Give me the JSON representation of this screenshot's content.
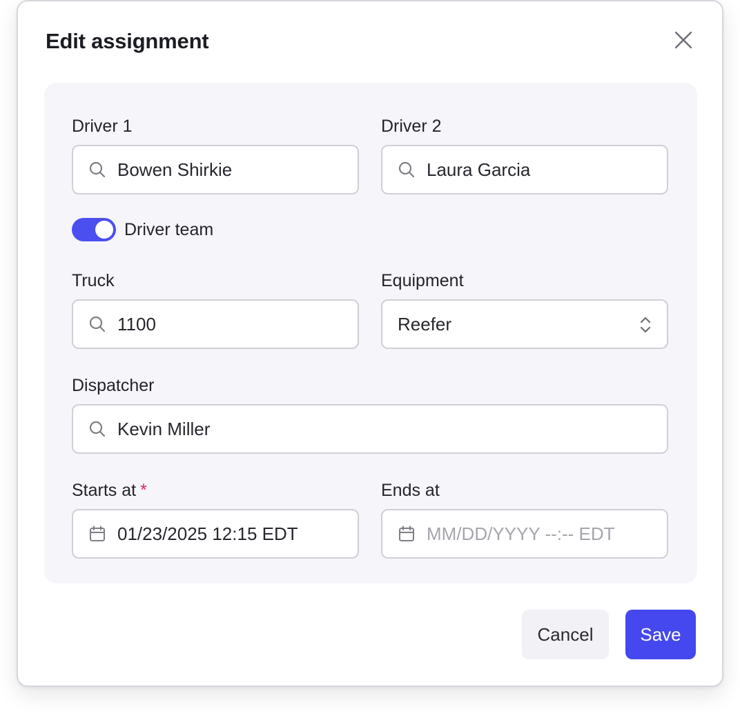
{
  "dialog": {
    "title": "Edit assignment",
    "close_icon": "close-icon"
  },
  "form": {
    "driver1": {
      "label": "Driver 1",
      "value": "Bowen Shirkie",
      "icon": "search-icon"
    },
    "driver2": {
      "label": "Driver 2",
      "value": "Laura Garcia",
      "icon": "search-icon"
    },
    "driver_team": {
      "label": "Driver team",
      "checked": true
    },
    "truck": {
      "label": "Truck",
      "value": "1100",
      "icon": "search-icon"
    },
    "equipment": {
      "label": "Equipment",
      "value": "Reefer",
      "icon": "chevron-up-down-icon"
    },
    "dispatcher": {
      "label": "Dispatcher",
      "value": "Kevin Miller",
      "icon": "search-icon"
    },
    "starts_at": {
      "label": "Starts at",
      "required_mark": "*",
      "value": "01/23/2025 12:15 EDT",
      "icon": "calendar-icon"
    },
    "ends_at": {
      "label": "Ends at",
      "placeholder": "MM/DD/YYYY --:-- EDT",
      "icon": "calendar-icon"
    }
  },
  "actions": {
    "cancel_label": "Cancel",
    "save_label": "Save"
  },
  "colors": {
    "accent": "#4448ee",
    "panel_bg": "#f6f6fa",
    "required": "#e0245e"
  }
}
